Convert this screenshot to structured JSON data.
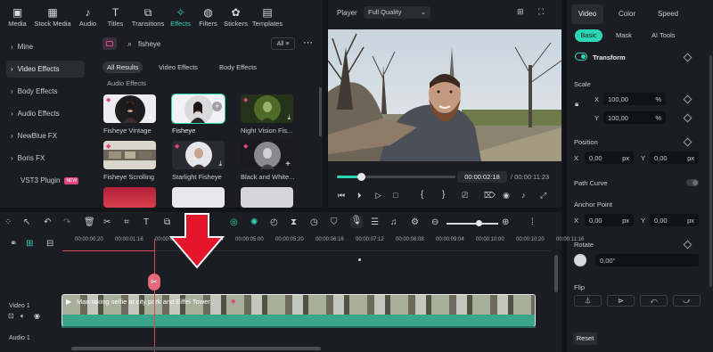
{
  "toolbar": {
    "items": [
      {
        "label": "Media",
        "icon": "media-icon"
      },
      {
        "label": "Stock Media",
        "icon": "stock-media-icon"
      },
      {
        "label": "Audio",
        "icon": "audio-icon"
      },
      {
        "label": "Titles",
        "icon": "titles-icon"
      },
      {
        "label": "Transitions",
        "icon": "transitions-icon"
      },
      {
        "label": "Effects",
        "icon": "effects-icon"
      },
      {
        "label": "Filters",
        "icon": "filters-icon"
      },
      {
        "label": "Stickers",
        "icon": "stickers-icon"
      },
      {
        "label": "Templates",
        "icon": "templates-icon"
      }
    ],
    "active": "Effects"
  },
  "sidebar": {
    "items": [
      {
        "label": "Mine"
      },
      {
        "label": "Video Effects"
      },
      {
        "label": "Body Effects"
      },
      {
        "label": "Audio Effects"
      },
      {
        "label": "NewBlue FX"
      },
      {
        "label": "Boris FX"
      },
      {
        "label": "VST3 Plugin",
        "badge": "NEW"
      }
    ]
  },
  "effects": {
    "search_value": "fisheye",
    "filter_label": "All",
    "tabs": [
      "All Results",
      "Video Effects",
      "Body Effects"
    ],
    "section_label": "Audio Effects",
    "items": [
      {
        "name": "Fisheye Vintage"
      },
      {
        "name": "Fisheye"
      },
      {
        "name": "Night Vision Fis..."
      },
      {
        "name": "Fisheye Scrolling"
      },
      {
        "name": "Starlight Fisheye"
      },
      {
        "name": "Black and White..."
      }
    ]
  },
  "player": {
    "label": "Player",
    "quality": "Full Quality",
    "current_time": "00:00:02:18",
    "total_time": "/ 00:00:11:23",
    "progress": 0.2
  },
  "props": {
    "tabs": [
      "Video",
      "Color",
      "Speed"
    ],
    "subtabs": [
      "Basic",
      "Mask",
      "AI Tools"
    ],
    "transform_label": "Transform",
    "scale_label": "Scale",
    "scale_x": "100,00",
    "scale_y": "100,00",
    "pct": "%",
    "position_label": "Position",
    "pos_x": "0,00",
    "pos_y": "0,00",
    "px": "px",
    "path_curve_label": "Path Curve",
    "anchor_label": "Anchor Point",
    "anchor_x": "0,00",
    "anchor_y": "0,00",
    "rotate_label": "Rotate",
    "rotate_value": "0,00°",
    "flip_label": "Flip",
    "reset_label": "Reset",
    "x": "X",
    "y": "Y"
  },
  "timeline": {
    "ruler": [
      "00:00:00:20",
      "00:00:01:16",
      "00:00:0",
      "00:00:04:04",
      "00:00:05:00",
      "00:00:05:20",
      "00:00:06:16",
      "00:00:07:12",
      "00:00:08:08",
      "00:00:09:04",
      "00:00:10:00",
      "00:00:10:20",
      "00:00:11:16"
    ],
    "clip_title": "Man taking selfie at city park and Eiffel Tower",
    "track_video": "Video 1",
    "track_audio": "Audio 1"
  }
}
